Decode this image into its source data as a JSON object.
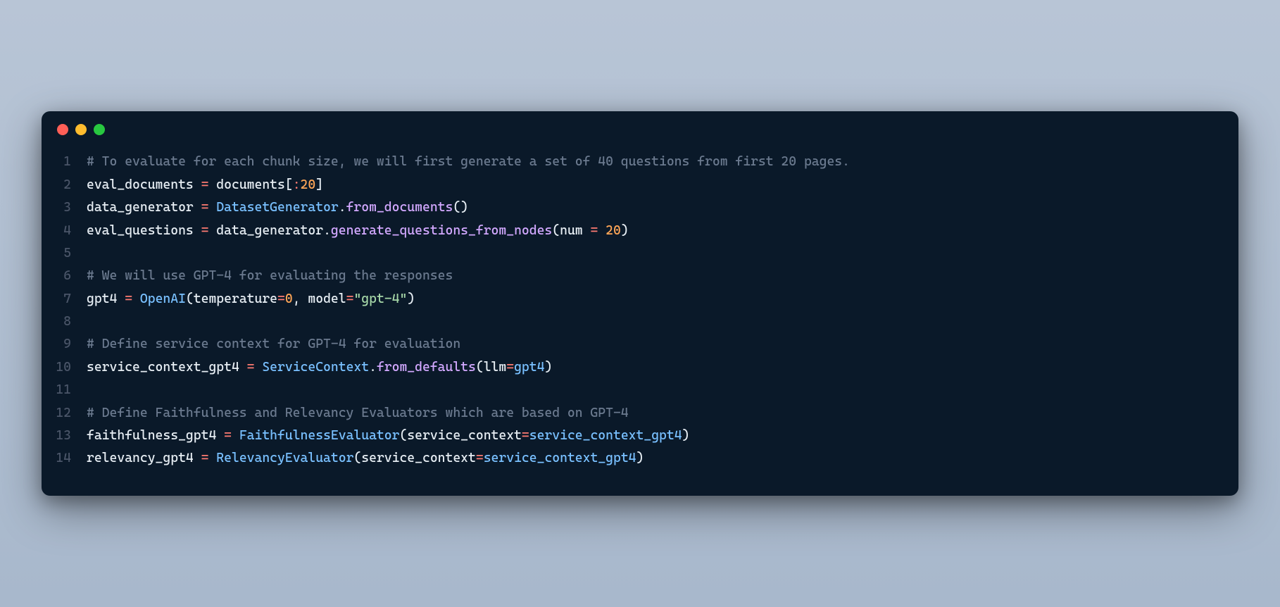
{
  "window": {
    "traffic_lights": [
      "close",
      "minimize",
      "zoom"
    ]
  },
  "code": {
    "language": "python",
    "lines": [
      {
        "n": 1,
        "tokens": [
          {
            "t": "# To evaluate for each chunk size, we will first generate a set of 40 questions from first 20 pages.",
            "c": "comment"
          }
        ]
      },
      {
        "n": 2,
        "tokens": [
          {
            "t": "eval_documents ",
            "c": "ident"
          },
          {
            "t": "=",
            "c": "op"
          },
          {
            "t": " documents[",
            "c": "ident"
          },
          {
            "t": ":",
            "c": "op"
          },
          {
            "t": "20",
            "c": "num"
          },
          {
            "t": "]",
            "c": "ident"
          }
        ]
      },
      {
        "n": 3,
        "tokens": [
          {
            "t": "data_generator ",
            "c": "ident"
          },
          {
            "t": "=",
            "c": "op"
          },
          {
            "t": " ",
            "c": "ident"
          },
          {
            "t": "DatasetGenerator",
            "c": "class"
          },
          {
            "t": ".",
            "c": "punct"
          },
          {
            "t": "from_documents",
            "c": "func"
          },
          {
            "t": "()",
            "c": "punct"
          }
        ]
      },
      {
        "n": 4,
        "tokens": [
          {
            "t": "eval_questions ",
            "c": "ident"
          },
          {
            "t": "=",
            "c": "op"
          },
          {
            "t": " data_generator",
            "c": "ident"
          },
          {
            "t": ".",
            "c": "punct"
          },
          {
            "t": "generate_questions_from_nodes",
            "c": "func"
          },
          {
            "t": "(",
            "c": "punct"
          },
          {
            "t": "num ",
            "c": "param"
          },
          {
            "t": "=",
            "c": "op"
          },
          {
            "t": " ",
            "c": "ident"
          },
          {
            "t": "20",
            "c": "num"
          },
          {
            "t": ")",
            "c": "punct"
          }
        ]
      },
      {
        "n": 5,
        "tokens": [
          {
            "t": "",
            "c": "ident"
          }
        ]
      },
      {
        "n": 6,
        "tokens": [
          {
            "t": "# We will use GPT-4 for evaluating the responses",
            "c": "comment"
          }
        ]
      },
      {
        "n": 7,
        "tokens": [
          {
            "t": "gpt4 ",
            "c": "ident"
          },
          {
            "t": "=",
            "c": "op"
          },
          {
            "t": " ",
            "c": "ident"
          },
          {
            "t": "OpenAI",
            "c": "class"
          },
          {
            "t": "(",
            "c": "punct"
          },
          {
            "t": "temperature",
            "c": "param"
          },
          {
            "t": "=",
            "c": "op"
          },
          {
            "t": "0",
            "c": "num"
          },
          {
            "t": ", ",
            "c": "punct"
          },
          {
            "t": "model",
            "c": "param"
          },
          {
            "t": "=",
            "c": "op"
          },
          {
            "t": "\"gpt-4\"",
            "c": "str"
          },
          {
            "t": ")",
            "c": "punct"
          }
        ]
      },
      {
        "n": 8,
        "tokens": [
          {
            "t": "",
            "c": "ident"
          }
        ]
      },
      {
        "n": 9,
        "tokens": [
          {
            "t": "# Define service context for GPT-4 for evaluation",
            "c": "comment"
          }
        ]
      },
      {
        "n": 10,
        "tokens": [
          {
            "t": "service_context_gpt4 ",
            "c": "ident"
          },
          {
            "t": "=",
            "c": "op"
          },
          {
            "t": " ",
            "c": "ident"
          },
          {
            "t": "ServiceContext",
            "c": "class"
          },
          {
            "t": ".",
            "c": "punct"
          },
          {
            "t": "from_defaults",
            "c": "func"
          },
          {
            "t": "(",
            "c": "punct"
          },
          {
            "t": "llm",
            "c": "param"
          },
          {
            "t": "=",
            "c": "op"
          },
          {
            "t": "gpt4",
            "c": "kwarg"
          },
          {
            "t": ")",
            "c": "punct"
          }
        ]
      },
      {
        "n": 11,
        "tokens": [
          {
            "t": "",
            "c": "ident"
          }
        ]
      },
      {
        "n": 12,
        "tokens": [
          {
            "t": "# Define Faithfulness and Relevancy Evaluators which are based on GPT-4",
            "c": "comment"
          }
        ]
      },
      {
        "n": 13,
        "tokens": [
          {
            "t": "faithfulness_gpt4 ",
            "c": "ident"
          },
          {
            "t": "=",
            "c": "op"
          },
          {
            "t": " ",
            "c": "ident"
          },
          {
            "t": "FaithfulnessEvaluator",
            "c": "class"
          },
          {
            "t": "(",
            "c": "punct"
          },
          {
            "t": "service_context",
            "c": "param"
          },
          {
            "t": "=",
            "c": "op"
          },
          {
            "t": "service_context_gpt4",
            "c": "kwarg"
          },
          {
            "t": ")",
            "c": "punct"
          }
        ]
      },
      {
        "n": 14,
        "tokens": [
          {
            "t": "relevancy_gpt4 ",
            "c": "ident"
          },
          {
            "t": "=",
            "c": "op"
          },
          {
            "t": " ",
            "c": "ident"
          },
          {
            "t": "RelevancyEvaluator",
            "c": "class"
          },
          {
            "t": "(",
            "c": "punct"
          },
          {
            "t": "service_context",
            "c": "param"
          },
          {
            "t": "=",
            "c": "op"
          },
          {
            "t": "service_context_gpt4",
            "c": "kwarg"
          },
          {
            "t": ")",
            "c": "punct"
          }
        ]
      }
    ]
  }
}
